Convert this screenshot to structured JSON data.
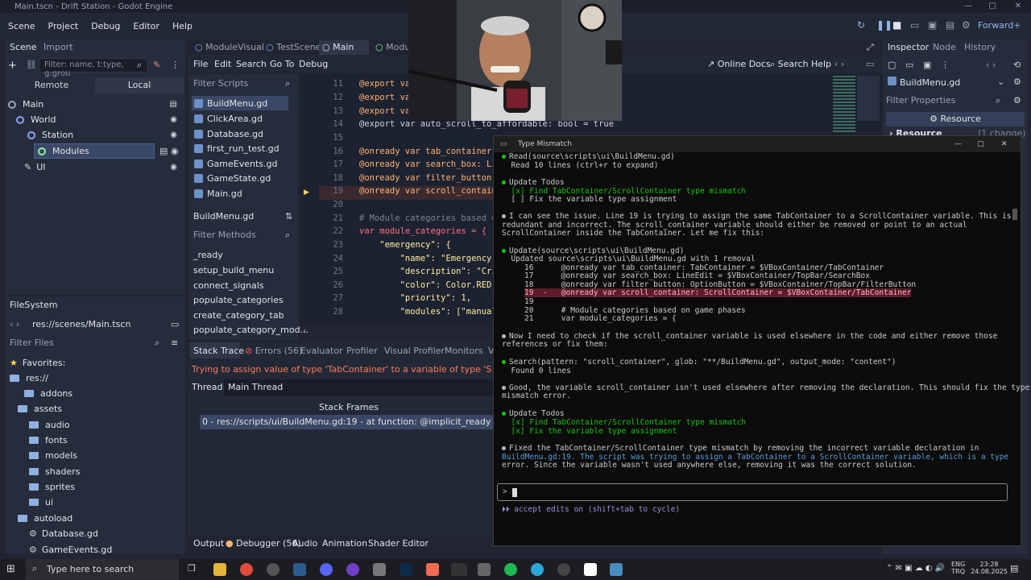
{
  "window": {
    "title": "Main.tscn - Drift Station - Godot Engine"
  },
  "menu": {
    "items": [
      "Scene",
      "Project",
      "Debug",
      "Editor",
      "Help"
    ],
    "renderer": "Forward+"
  },
  "scene_dock": {
    "tab_scene": "Scene",
    "tab_import": "Import",
    "filter_placeholder": "Filter: name, t:type, g:grou",
    "remote_label": "Remote",
    "local_label": "Local",
    "nodes": [
      {
        "name": "Main"
      },
      {
        "name": "World"
      },
      {
        "name": "Station"
      },
      {
        "name": "Modules"
      },
      {
        "name": "UI"
      }
    ]
  },
  "filesystem": {
    "title": "FileSystem",
    "path": "res://scenes/Main.tscn",
    "filter_placeholder": "Filter Files",
    "items": [
      {
        "name": "Favorites:"
      },
      {
        "name": "res://"
      },
      {
        "name": "addons"
      },
      {
        "name": "assets"
      },
      {
        "name": "audio"
      },
      {
        "name": "fonts"
      },
      {
        "name": "models"
      },
      {
        "name": "shaders"
      },
      {
        "name": "sprites"
      },
      {
        "name": "ui"
      },
      {
        "name": "autoload"
      },
      {
        "name": "Database.gd"
      },
      {
        "name": "GameEvents.gd"
      }
    ]
  },
  "editor_tabs": [
    "ModuleVisual",
    "TestScene",
    "Main",
    "Modu"
  ],
  "script_menu": {
    "items": [
      "File",
      "Edit",
      "Search",
      "Go To",
      "Debug"
    ],
    "online_docs": "Online Docs",
    "search_help": "Search Help"
  },
  "scripts_panel": {
    "filter_placeholder": "Filter Scripts",
    "scripts": [
      "BuildMenu.gd",
      "ClickArea.gd",
      "Database.gd",
      "first_run_test.gd",
      "GameEvents.gd",
      "GameState.gd",
      "Main.gd"
    ],
    "current": "BuildMenu.gd",
    "methods_placeholder": "Filter Methods",
    "methods": [
      "_ready",
      "setup_build_menu",
      "connect_signals",
      "populate_categories",
      "create_category_tab",
      "populate_category_mod..."
    ]
  },
  "code": {
    "lines": [
      {
        "n": "11",
        "text": "@export var"
      },
      {
        "n": "12",
        "text": "@export var"
      },
      {
        "n": "13",
        "text": "@export var"
      },
      {
        "n": "14",
        "text": "@export var auto_scroll_to_affordable: bool = true"
      },
      {
        "n": "15",
        "text": ""
      },
      {
        "n": "16",
        "text": "@onready var tab_container: Ta"
      },
      {
        "n": "17",
        "text": "@onready var search_box: LineE"
      },
      {
        "n": "18",
        "text": "@onready var filter_button: Op"
      },
      {
        "n": "19",
        "text": "@onready var scroll_container:"
      },
      {
        "n": "20",
        "text": ""
      },
      {
        "n": "21",
        "text": "# Module categories based on"
      },
      {
        "n": "22",
        "text": "var module_categories = {"
      },
      {
        "n": "23",
        "text": "    \"emergency\": {"
      },
      {
        "n": "24",
        "text": "        \"name\": \"Emergency\","
      },
      {
        "n": "25",
        "text": "        \"description\": \"Criti"
      },
      {
        "n": "26",
        "text": "        \"color\": Color.RED,"
      },
      {
        "n": "27",
        "text": "        \"priority\": 1,"
      },
      {
        "n": "28",
        "text": "        \"modules\": [\"manual_ge"
      }
    ]
  },
  "debugger": {
    "tabs": [
      "Stack Trace",
      "Errors (56)",
      "Evaluator",
      "Profiler",
      "Visual Profiler",
      "Monitors",
      "V"
    ],
    "error_message": "Trying to assign value of type 'TabContainer' to a variable of type 'ScrollContainer'.",
    "thread_label": "Thread:",
    "thread_value": "Main Thread",
    "stack_frames_label": "Stack Frames",
    "frame": "0 - res://scripts/ui/BuildMenu.gd:19 - at function: @implicit_ready"
  },
  "bottom_bar": {
    "items": [
      "Output",
      "Debugger (56)",
      "Audio",
      "Animation",
      "Shader Editor"
    ]
  },
  "inspector": {
    "tabs": [
      "Inspector",
      "Node",
      "History"
    ],
    "file": "BuildMenu.gd",
    "filter_placeholder": "Filter Properties",
    "resource_btn": "Resource",
    "resource_section": "Resource",
    "change_count": "(1 change)"
  },
  "terminal": {
    "title": "Type Mismatch",
    "lines": [
      "Read(source\\scripts\\ui\\BuildMenu.gd)",
      "  Read 10 lines (ctrl+r to expand)",
      "Update Todos",
      "  [x] Find TabContainer/ScrollContainer type mismatch",
      "  [ ] Fix the variable type assignment",
      "I can see the issue. Line 19 is trying to assign the same TabContainer to a ScrollContainer variable. This is",
      "redundant and incorrect. The scroll_container variable should either be removed or point to an actual",
      "ScrollContainer inside the TabContainer. Let me fix this:",
      "Update(source\\scripts\\ui\\BuildMenu.gd)",
      "  Updated source\\scripts\\ui\\BuildMenu.gd with 1 removal",
      "16      @onready var tab_container: TabContainer = $VBoxContainer/TabContainer",
      "17      @onready var search_box: LineEdit = $VBoxContainer/TopBar/SearchBox",
      "18      @onready var filter_button: OptionButton = $VBoxContainer/TopBar/FilterButton",
      "19  -   @onready var scroll_container: ScrollContainer = $VBoxContainer/TabContainer",
      "19",
      "20      # Module categories based on game phases",
      "21      var module_categories = {",
      "Now I need to check if the scroll_container variable is used elsewhere in the code and either remove those",
      "references or fix them:",
      "Search(pattern: \"scroll_container\", glob: \"**/BuildMenu.gd\", output_mode: \"content\")",
      "  Found 0 lines",
      "Good, the variable scroll_container isn't used elsewhere after removing the declaration. This should fix the type",
      "mismatch error.",
      "Update Todos",
      "  [x] Find TabContainer/ScrollContainer type mismatch",
      "  [x] Fix the variable type assignment",
      "Fixed the TabContainer/ScrollContainer type mismatch by removing the incorrect variable declaration in",
      "BuildMenu.gd:19. The script was trying to assign a TabContainer to a ScrollContainer variable, which is a type",
      "error. Since the variable wasn't used anywhere else, removing it was the correct solution."
    ],
    "prompt": ">",
    "footer": "accept edits on (shift+tab to cycle)"
  },
  "taskbar": {
    "search_placeholder": "Type here to search",
    "lang1": "ENG",
    "lang2": "TRQ",
    "time": "23:28",
    "date": "24.08.2025"
  },
  "colors": {
    "accent": "#3a4866",
    "error": "#ff5d5d",
    "terminal_bg": "#0c0c0c",
    "success": "#16c60c"
  }
}
